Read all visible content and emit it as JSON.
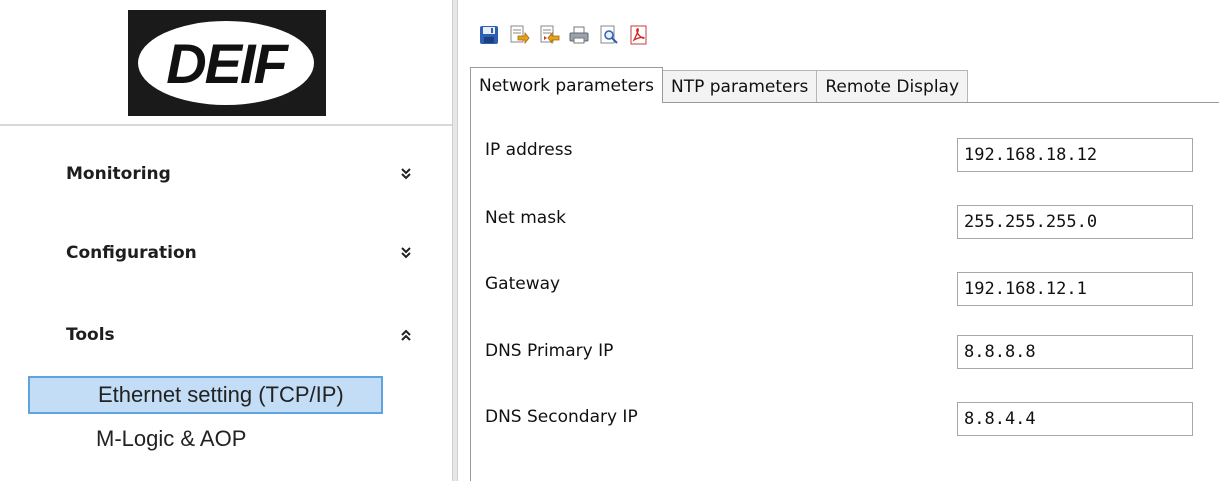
{
  "sidebar": {
    "logo_text": "DEIF",
    "sections": [
      {
        "label": "Monitoring",
        "state_icon": "double-chevron-down-icon"
      },
      {
        "label": "Configuration",
        "state_icon": "double-chevron-down-icon"
      },
      {
        "label": "Tools",
        "state_icon": "double-chevron-up-icon"
      }
    ],
    "tools_items": [
      {
        "label": "Ethernet setting (TCP/IP)",
        "selected": true
      },
      {
        "label": "M-Logic & AOP",
        "selected": false
      }
    ]
  },
  "toolbar": {
    "buttons": [
      "save-icon",
      "write-icon",
      "read-icon",
      "print-icon",
      "print-preview-icon",
      "pdf-export-icon"
    ]
  },
  "tabs": [
    {
      "label": "Network parameters",
      "active": true
    },
    {
      "label": "NTP parameters",
      "active": false
    },
    {
      "label": "Remote Display",
      "active": false
    }
  ],
  "network": {
    "fields": [
      {
        "label": "IP address",
        "value": "192.168.18.12"
      },
      {
        "label": "Net mask",
        "value": "255.255.255.0"
      },
      {
        "label": "Gateway",
        "value": "192.168.12.1"
      },
      {
        "label": "DNS Primary IP",
        "value": "8.8.8.8"
      },
      {
        "label": "DNS Secondary IP",
        "value": "8.8.4.4"
      }
    ]
  },
  "colors": {
    "selection_bg": "#c2ddf5",
    "selection_border": "#5fa3df",
    "logo_bg": "#1a1a1a"
  }
}
